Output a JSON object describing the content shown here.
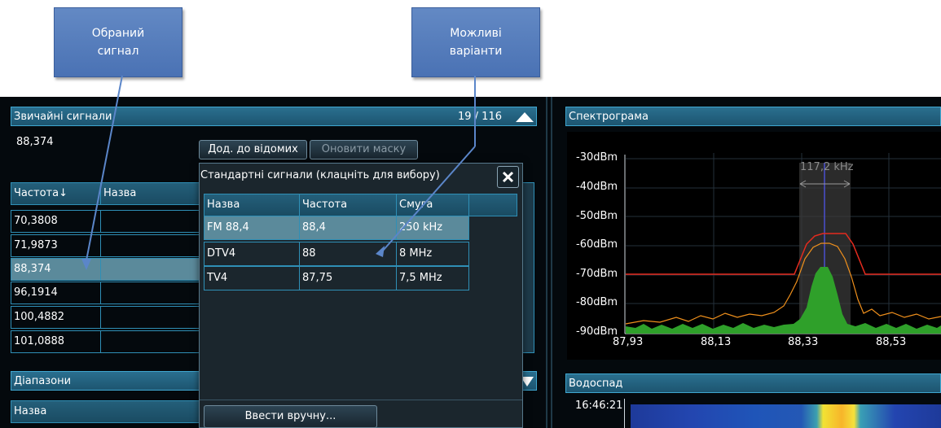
{
  "callouts": {
    "selected_signal": [
      "Обраний",
      "сигнал"
    ],
    "possible_options": [
      "Можливі",
      "варіанти"
    ]
  },
  "signals_panel": {
    "title": "Звичайні сигнали",
    "count": "19 / 116",
    "current_value": "88,374",
    "add_known_label": "Дод. до відомих",
    "update_mask_label": "Оновити маску",
    "columns": [
      "Частота↓",
      "Назва"
    ],
    "rows": [
      {
        "freq": "70,3808",
        "name": ""
      },
      {
        "freq": "71,9873",
        "name": ""
      },
      {
        "freq": "88,374",
        "name": ""
      },
      {
        "freq": "96,1914",
        "name": ""
      },
      {
        "freq": "100,4882",
        "name": ""
      },
      {
        "freq": "101,0888",
        "name": ""
      }
    ],
    "selected_row_index": 2
  },
  "ranges_panel": {
    "title": "Діапазони",
    "columns": [
      "Назва"
    ]
  },
  "standard_signals_popup": {
    "title": "Стандартні сигнали (клацніть для вибору)",
    "columns": [
      "Назва",
      "Частота",
      "Смуга",
      ""
    ],
    "rows": [
      {
        "name": "FM 88,4",
        "freq": "88,4",
        "band": "250 kHz"
      },
      {
        "name": "DTV4",
        "freq": "88",
        "band": "8 MHz"
      },
      {
        "name": "TV4",
        "freq": "87,75",
        "band": "7,5 MHz"
      }
    ],
    "selected_row_index": 0,
    "manual_entry_label": "Ввести вручну..."
  },
  "spectrogram": {
    "title": "Спектрограма",
    "bandwidth_label": "117,2 kHz",
    "y_ticks": [
      "-30dBm",
      "-40dBm",
      "-50dBm",
      "-60dBm",
      "-70dBm",
      "-80dBm",
      "-90dBm"
    ],
    "x_ticks": [
      "87,93",
      "88,13",
      "88,33",
      "88,53"
    ]
  },
  "waterfall": {
    "title": "Водоспад",
    "time_label": "16:46:21"
  },
  "colors": {
    "header": "#1d5570",
    "border": "#2f8fb6",
    "selected_row": "#5b8a9b",
    "callout": "#4a72b4",
    "mask_line": "#e52b1e",
    "max_hold_line": "#f0901c",
    "spectrum_fill": "#2fa02a"
  }
}
